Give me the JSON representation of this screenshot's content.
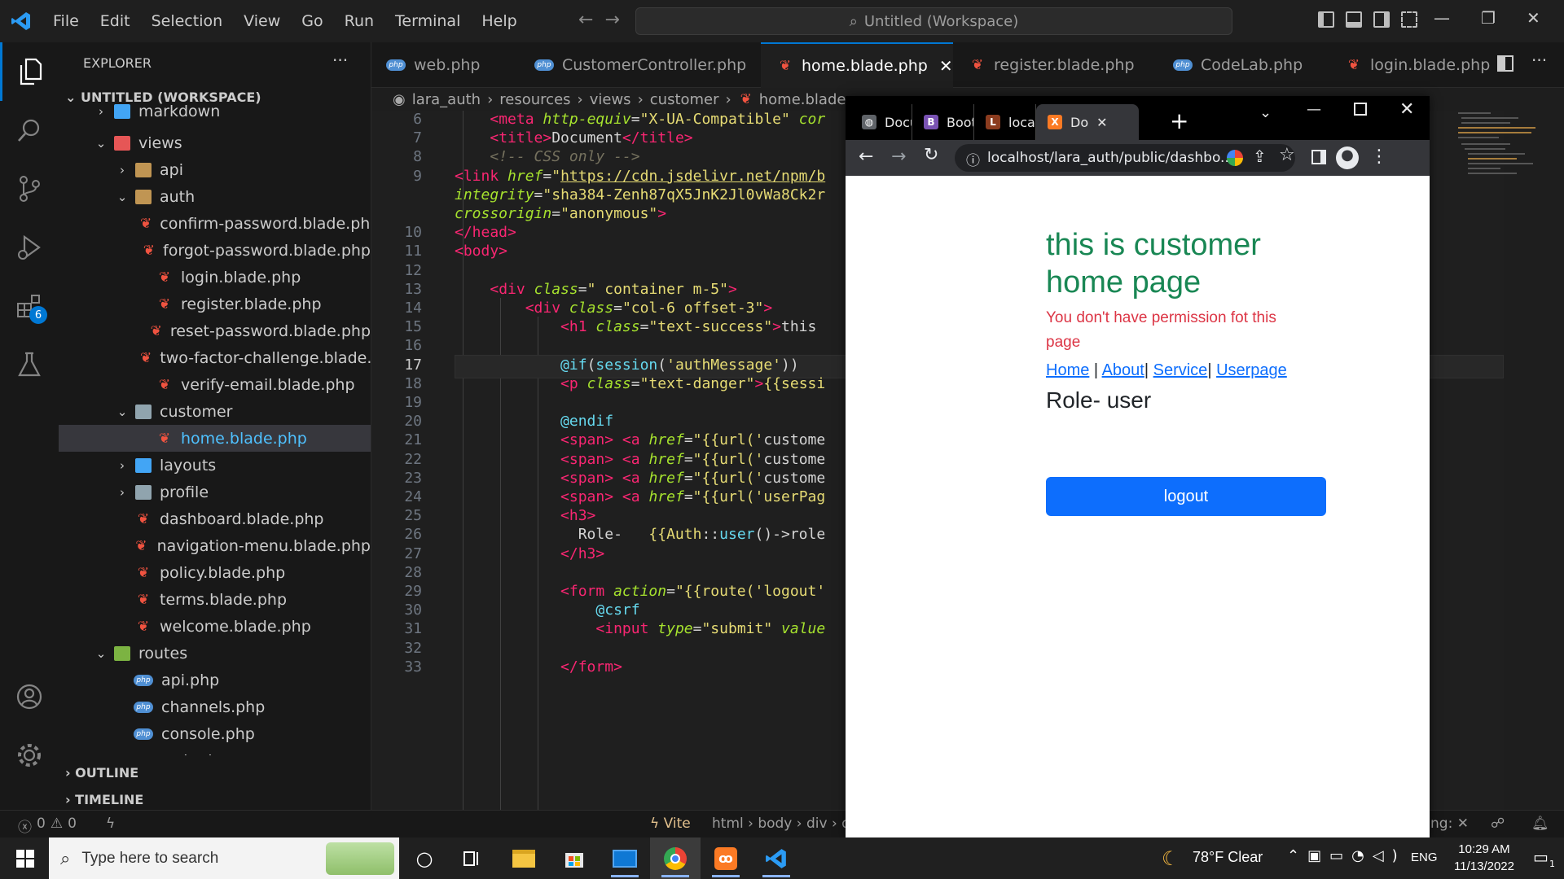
{
  "titlebar": {
    "menu": [
      "File",
      "Edit",
      "Selection",
      "View",
      "Go",
      "Run",
      "Terminal",
      "Help"
    ],
    "search_text": "Untitled (Workspace)"
  },
  "activity": {
    "extensions_badge": "6"
  },
  "sidebar": {
    "title": "EXPLORER",
    "workspace": "UNTITLED (WORKSPACE)",
    "items": [
      {
        "label": "markdown",
        "kind": "folder-blue",
        "indent": 1,
        "chev": "›"
      },
      {
        "label": "views",
        "kind": "folder-red",
        "indent": 1,
        "chev": "⌄"
      },
      {
        "label": "api",
        "kind": "folder",
        "indent": 2,
        "chev": "›"
      },
      {
        "label": "auth",
        "kind": "folder",
        "indent": 2,
        "chev": "⌄"
      },
      {
        "label": "confirm-password.blade.php",
        "kind": "blade",
        "indent": 3
      },
      {
        "label": "forgot-password.blade.php",
        "kind": "blade",
        "indent": 3
      },
      {
        "label": "login.blade.php",
        "kind": "blade",
        "indent": 3
      },
      {
        "label": "register.blade.php",
        "kind": "blade",
        "indent": 3
      },
      {
        "label": "reset-password.blade.php",
        "kind": "blade",
        "indent": 3
      },
      {
        "label": "two-factor-challenge.blade....",
        "kind": "blade",
        "indent": 3
      },
      {
        "label": "verify-email.blade.php",
        "kind": "blade",
        "indent": 3
      },
      {
        "label": "customer",
        "kind": "folder-grey",
        "indent": 2,
        "chev": "⌄"
      },
      {
        "label": "home.blade.php",
        "kind": "blade",
        "indent": 3,
        "selected": true
      },
      {
        "label": "layouts",
        "kind": "folder-blue",
        "indent": 2,
        "chev": "›"
      },
      {
        "label": "profile",
        "kind": "folder-grey",
        "indent": 2,
        "chev": "›"
      },
      {
        "label": "dashboard.blade.php",
        "kind": "blade",
        "indent": 2
      },
      {
        "label": "navigation-menu.blade.php",
        "kind": "blade",
        "indent": 2
      },
      {
        "label": "policy.blade.php",
        "kind": "blade",
        "indent": 2
      },
      {
        "label": "terms.blade.php",
        "kind": "blade",
        "indent": 2
      },
      {
        "label": "welcome.blade.php",
        "kind": "blade",
        "indent": 2
      },
      {
        "label": "routes",
        "kind": "folder-green",
        "indent": 1,
        "chev": "⌄"
      },
      {
        "label": "api.php",
        "kind": "php",
        "indent": 2
      },
      {
        "label": "channels.php",
        "kind": "php",
        "indent": 2
      },
      {
        "label": "console.php",
        "kind": "php",
        "indent": 2
      },
      {
        "label": "web.php",
        "kind": "php",
        "indent": 2
      }
    ],
    "outline": "OUTLINE",
    "timeline": "TIMELINE"
  },
  "tabs": [
    {
      "label": "web.php",
      "kind": "php"
    },
    {
      "label": "CustomerController.php",
      "kind": "php"
    },
    {
      "label": "home.blade.php",
      "kind": "blade",
      "active": true
    },
    {
      "label": "register.blade.php",
      "kind": "blade"
    },
    {
      "label": "CodeLab.php",
      "kind": "php"
    },
    {
      "label": "login.blade.php",
      "kind": "blade"
    }
  ],
  "breadcrumb": [
    "lara_auth",
    "resources",
    "views",
    "customer",
    "home.blade..."
  ],
  "code": {
    "lines": [
      {
        "n": "6",
        "html": "    <span class='tagc'>&lt;meta</span> <span class='attr'>http-equiv</span>=<span class='str'>\"X-UA-Compatible\"</span> <span class='attr'>cor</span>"
      },
      {
        "n": "7",
        "html": "    <span class='tagc'>&lt;title&gt;</span>Document<span class='tagc'>&lt;/title&gt;</span>"
      },
      {
        "n": "8",
        "html": "    <span class='cmt'>&lt;!-- CSS only --&gt;</span>"
      },
      {
        "n": "9",
        "html": "<span class='tagc'>&lt;link</span> <span class='attr'>href</span>=<span class='str'>\"<u>https://cdn.jsdelivr.net/npm/b</u></span>"
      },
      {
        "n": "",
        "html": "<span class='attr'>integrity</span>=<span class='str'>\"sha384-Zenh87qX5JnK2Jl0vWa8Ck2r</span>"
      },
      {
        "n": "",
        "html": "<span class='attr'>crossorigin</span>=<span class='str'>\"anonymous\"</span><span class='tagc'>&gt;</span>"
      },
      {
        "n": "10",
        "html": "<span class='tagc'>&lt;/head&gt;</span>"
      },
      {
        "n": "11",
        "html": "<span class='tagc'>&lt;body&gt;</span>"
      },
      {
        "n": "12",
        "html": ""
      },
      {
        "n": "13",
        "html": "    <span class='tagc'>&lt;div</span> <span class='attr'>class</span>=<span class='str'>\" container m-5\"</span><span class='tagc'>&gt;</span>"
      },
      {
        "n": "14",
        "html": "        <span class='tagc'>&lt;div</span> <span class='attr'>class</span>=<span class='str'>\"col-6 offset-3\"</span><span class='tagc'>&gt;</span>"
      },
      {
        "n": "15",
        "html": "            <span class='tagc'>&lt;h1</span> <span class='attr'>class</span>=<span class='str'>\"text-success\"</span><span class='tagc'>&gt;</span>this"
      },
      {
        "n": "16",
        "html": ""
      },
      {
        "n": "17",
        "html": "            <span class='dir'>@if</span>(<span class='dir'>session</span>(<span class='str'>'authMessage'</span>))",
        "cur": true
      },
      {
        "n": "18",
        "html": "            <span class='tagc'>&lt;p</span> <span class='attr'>class</span>=<span class='str'>\"text-danger\"</span><span class='tagc'>&gt;</span><span class='str'>{{sessi</span>"
      },
      {
        "n": "19",
        "html": ""
      },
      {
        "n": "20",
        "html": "            <span class='dir'>@endif</span>"
      },
      {
        "n": "21",
        "html": "            <span class='tagc'>&lt;span&gt;</span> <span class='tagc'>&lt;a</span> <span class='attr'>href</span>=<span class='str'>\"{{url('</span>custome"
      },
      {
        "n": "22",
        "html": "            <span class='tagc'>&lt;span&gt;</span> <span class='tagc'>&lt;a</span> <span class='attr'>href</span>=<span class='str'>\"{{url('</span>custome"
      },
      {
        "n": "23",
        "html": "            <span class='tagc'>&lt;span&gt;</span> <span class='tagc'>&lt;a</span> <span class='attr'>href</span>=<span class='str'>\"{{url('</span>custome"
      },
      {
        "n": "24",
        "html": "            <span class='tagc'>&lt;span&gt;</span> <span class='tagc'>&lt;a</span> <span class='attr'>href</span>=<span class='str'>\"{{url('userPag</span>"
      },
      {
        "n": "25",
        "html": "            <span class='tagc'>&lt;h3&gt;</span>"
      },
      {
        "n": "26",
        "html": "              Role-   <span class='str'>{{Auth</span>::<span class='dir'>user</span>()-&gt;role"
      },
      {
        "n": "27",
        "html": "            <span class='tagc'>&lt;/h3&gt;</span>"
      },
      {
        "n": "28",
        "html": ""
      },
      {
        "n": "29",
        "html": "            <span class='tagc'>&lt;form</span> <span class='attr'>action</span>=<span class='str'>\"{{route('logout'</span>"
      },
      {
        "n": "30",
        "html": "                <span class='dir'>@csrf</span>"
      },
      {
        "n": "31",
        "html": "                <span class='tagc'>&lt;input</span> <span class='attr'>type</span>=<span class='str'>\"submit\"</span> <span class='attr'>value</span>"
      },
      {
        "n": "32",
        "html": ""
      },
      {
        "n": "33",
        "html": "            <span class='tagc'>&lt;/form&gt;</span>"
      }
    ]
  },
  "statusbar": {
    "errors": "0",
    "warnings": "0",
    "vite": "Vite",
    "path": "html › body › div › di",
    "right_text": "ng:"
  },
  "browser": {
    "tabs": [
      {
        "label": "Docum",
        "fav": "globe",
        "color": "#5f6368"
      },
      {
        "label": "Bootst",
        "fav": "B",
        "color": "#7952b3"
      },
      {
        "label": "localho",
        "fav": "L",
        "color": "#8b3c1f"
      },
      {
        "label": "Do",
        "fav": "X",
        "color": "#fb7a24",
        "active": true
      }
    ],
    "url": "localhost/lara_auth/public/dashbo...",
    "page": {
      "heading": "this is customer home page",
      "message": "You don't have permission fot this page",
      "links": [
        "Home",
        "About",
        "Service",
        "Userpage"
      ],
      "role": "Role- user",
      "logout": "logout"
    }
  },
  "taskbar": {
    "search_placeholder": "Type here to search",
    "weather": "78°F  Clear",
    "lang": "ENG",
    "time": "10:29 AM",
    "date": "11/13/2022",
    "notif": "1"
  }
}
